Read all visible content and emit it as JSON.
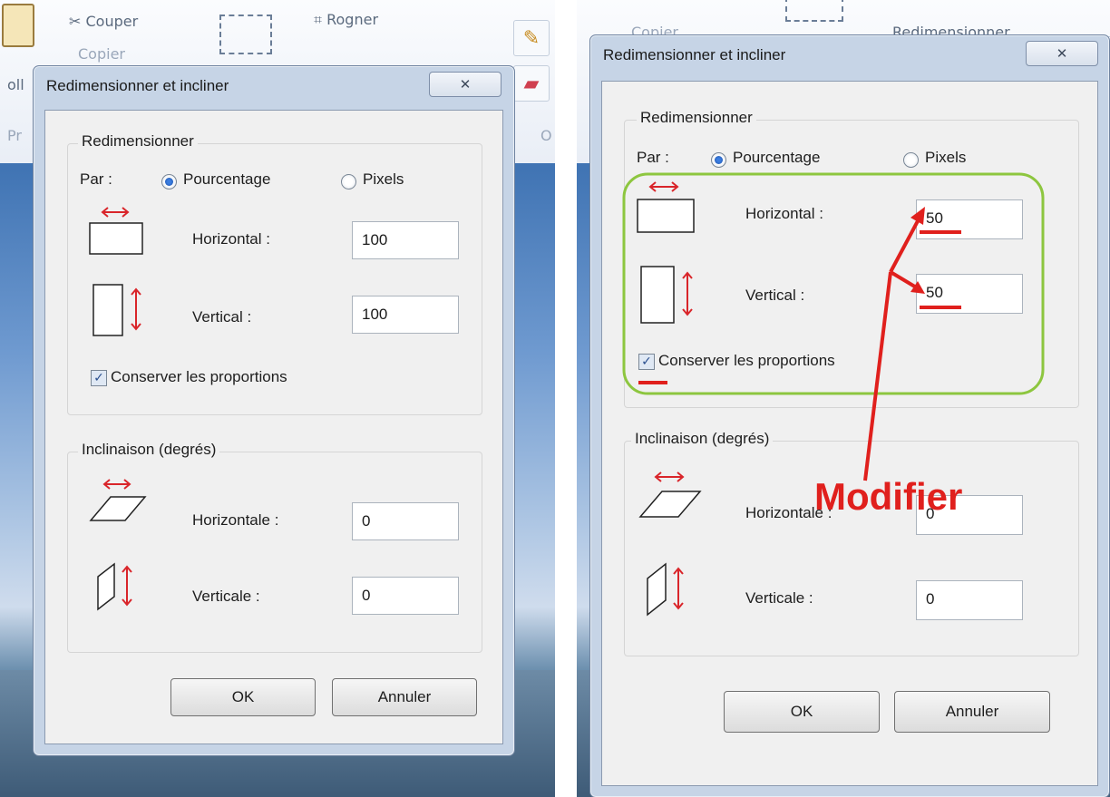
{
  "ribbon": {
    "cut_label": "Couper",
    "copy_label": "Copier",
    "crop_label": "Rogner",
    "resize_label": "Redimensionner",
    "partial_left_a": "oll",
    "partial_left_b": "Pr",
    "partial_right": "O"
  },
  "dialog": {
    "title": "Redimensionner et incliner",
    "close_glyph": "✕",
    "resize_group": "Redimensionner",
    "by_label": "Par :",
    "option_percent": "Pourcentage",
    "option_pixels": "Pixels",
    "horizontal_label": "Horizontal :",
    "vertical_label": "Vertical :",
    "keep_ratio_label": "Conserver les proportions",
    "skew_group": "Inclinaison (degrés)",
    "skew_h_label": "Horizontale :",
    "skew_v_label": "Verticale :",
    "ok_label": "OK",
    "cancel_label": "Annuler"
  },
  "before": {
    "horizontal": "100",
    "vertical": "100",
    "skew_h": "0",
    "skew_v": "0",
    "percent_selected": true,
    "keep_ratio": true
  },
  "after": {
    "horizontal": "50",
    "vertical": "50",
    "skew_h": "0",
    "skew_v": "0",
    "percent_selected": true,
    "keep_ratio": true
  },
  "annotation": {
    "text": "Modifier",
    "color": "#e0201d",
    "highlight_color": "#8dc63f"
  }
}
